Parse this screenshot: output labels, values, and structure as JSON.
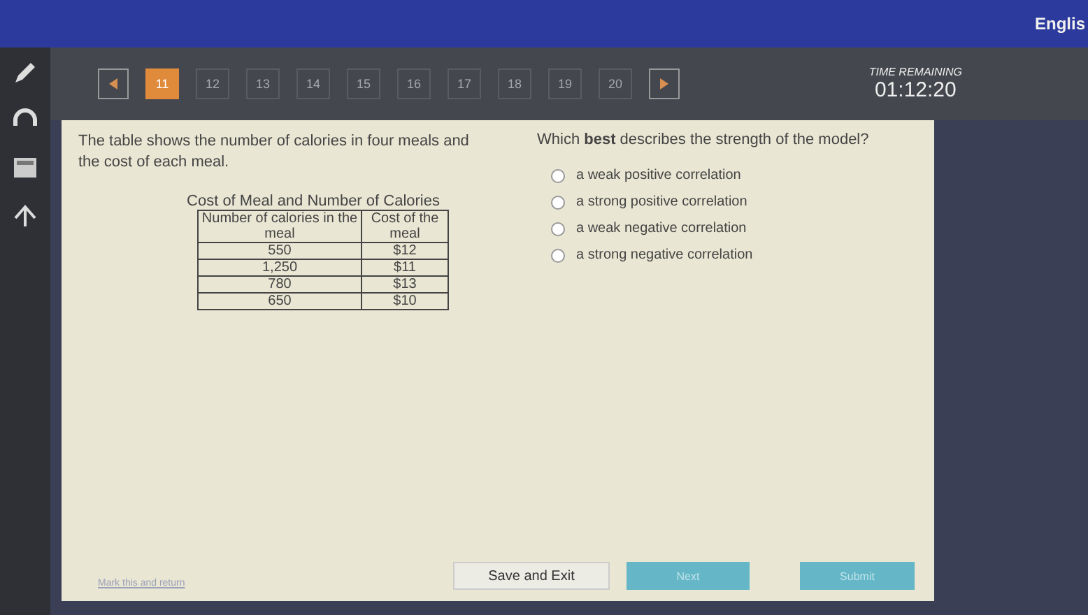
{
  "top_bar": {
    "language": "Englis"
  },
  "question_nav": {
    "items": [
      {
        "label": "11",
        "selected": true
      },
      {
        "label": "12",
        "selected": false
      },
      {
        "label": "13",
        "selected": false
      },
      {
        "label": "14",
        "selected": false
      },
      {
        "label": "15",
        "selected": false
      },
      {
        "label": "16",
        "selected": false
      },
      {
        "label": "17",
        "selected": false
      },
      {
        "label": "18",
        "selected": false
      },
      {
        "label": "19",
        "selected": false
      },
      {
        "label": "20",
        "selected": false
      }
    ]
  },
  "timer": {
    "label": "TIME REMAINING",
    "value": "01:12:20"
  },
  "prompt": "The table shows the number of calories in four meals and the cost of each meal.",
  "table": {
    "title": "Cost of Meal and Number of Calories",
    "columns": [
      "Number of calories in the meal",
      "Cost of the meal"
    ],
    "rows": [
      [
        "550",
        "$12"
      ],
      [
        "1,250",
        "$11"
      ],
      [
        "780",
        "$13"
      ],
      [
        "650",
        "$10"
      ]
    ]
  },
  "question": "Which **best** describes the strength of the model?",
  "options": [
    {
      "label": "a weak positive correlation",
      "selected": false
    },
    {
      "label": "a strong positive correlation",
      "selected": false
    },
    {
      "label": "a weak negative correlation",
      "selected": false
    },
    {
      "label": "a strong negative correlation",
      "selected": false
    }
  ],
  "footer": {
    "mark_link": "Mark this and return",
    "save_button": "Save and Exit",
    "next_button": "Next",
    "submit_button": "Submit"
  }
}
